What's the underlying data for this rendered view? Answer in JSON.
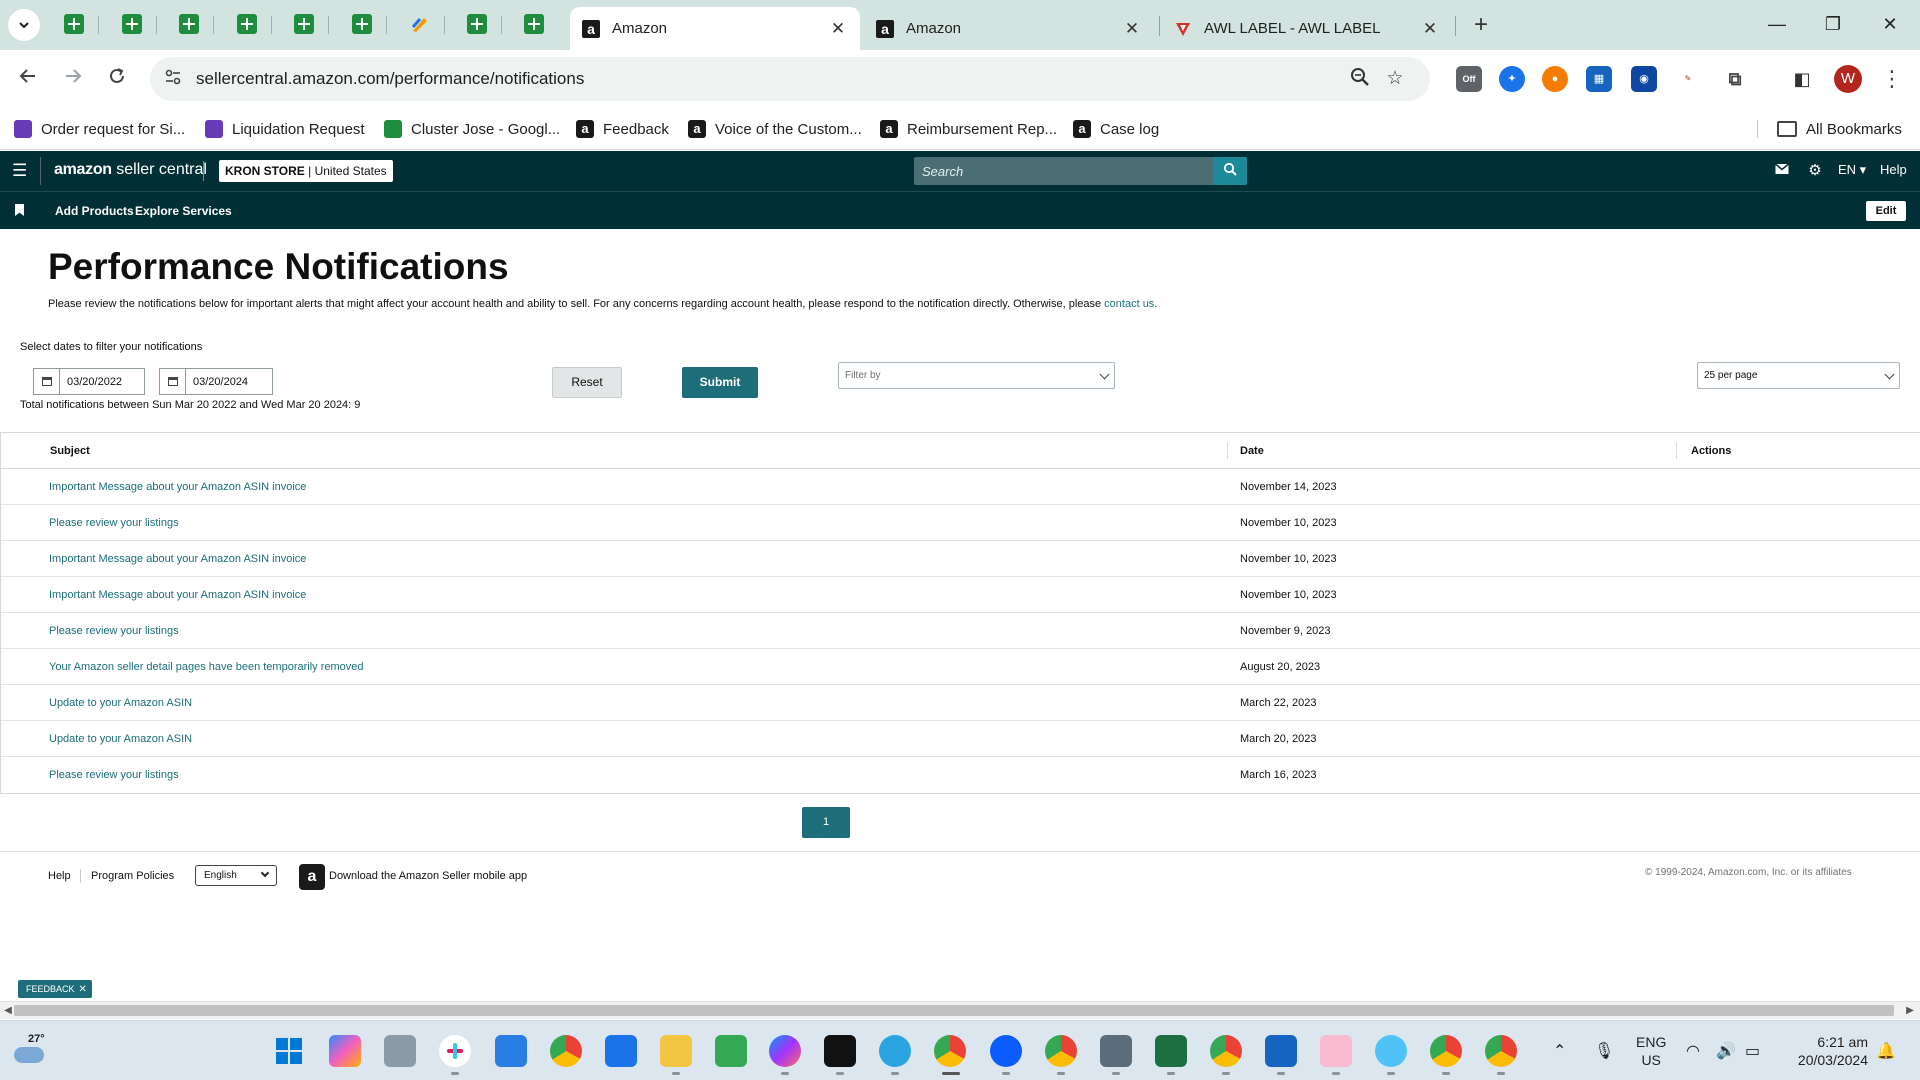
{
  "browser": {
    "tabs": [
      {
        "title": "Amazon",
        "active": true,
        "favicon": "amazon-icon"
      },
      {
        "title": "Amazon",
        "active": false,
        "favicon": "amazon-icon"
      },
      {
        "title": "AWL LABEL - AWL LABEL",
        "active": false,
        "favicon": "awl-label-icon"
      }
    ],
    "url": "sellercentral.amazon.com/performance/notifications",
    "bookmarks": [
      {
        "label": "Order request for Si...",
        "icon": "google-forms-icon"
      },
      {
        "label": "Liquidation Request",
        "icon": "google-forms-icon"
      },
      {
        "label": "Cluster Jose - Googl...",
        "icon": "google-sheets-icon"
      },
      {
        "label": "Feedback",
        "icon": "amazon-icon"
      },
      {
        "label": "Voice of the Custom...",
        "icon": "amazon-icon"
      },
      {
        "label": "Reimbursement Rep...",
        "icon": "amazon-icon"
      },
      {
        "label": "Case log",
        "icon": "amazon-icon"
      }
    ],
    "all_bookmarks": "All Bookmarks",
    "profile_initial": "W",
    "extension_badge": "Off"
  },
  "header": {
    "logo_brand": "amazon",
    "logo_product": "seller central",
    "store_name": "KRON STORE",
    "store_region": "United States",
    "search_placeholder": "Search",
    "language": "EN",
    "help": "Help"
  },
  "subnav": {
    "items": [
      "Add Products",
      "Explore Services"
    ],
    "edit": "Edit"
  },
  "page": {
    "title": "Performance Notifications",
    "intro": "Please review the notifications below for important alerts that might affect your account health and ability to sell. For any concerns regarding account health, please respond to the notification directly. Otherwise, please ",
    "contact_link": "contact us",
    "intro_end": ".",
    "filter_label": "Select dates to filter your notifications",
    "date_from": "03/20/2022",
    "date_to": "03/20/2024",
    "total_text": "Total notifications between Sun Mar 20 2022 and Wed Mar 20 2024: 9",
    "reset": "Reset",
    "submit": "Submit",
    "filter_by_placeholder": "Filter by",
    "per_page": "25 per page"
  },
  "table": {
    "headers": {
      "subject": "Subject",
      "date": "Date",
      "actions": "Actions"
    },
    "rows": [
      {
        "subject": "Important Message about your Amazon ASIN invoice",
        "date": "November 14, 2023"
      },
      {
        "subject": "Please review your listings",
        "date": "November 10, 2023"
      },
      {
        "subject": "Important Message about your Amazon ASIN invoice",
        "date": "November 10, 2023"
      },
      {
        "subject": "Important Message about your Amazon ASIN invoice",
        "date": "November 10, 2023"
      },
      {
        "subject": "Please review your listings",
        "date": "November 9, 2023"
      },
      {
        "subject": "Your Amazon seller detail pages have been temporarily removed",
        "date": "August 20, 2023"
      },
      {
        "subject": "Update to your Amazon ASIN",
        "date": "March 22, 2023"
      },
      {
        "subject": "Update to your Amazon ASIN",
        "date": "March 20, 2023"
      },
      {
        "subject": "Please review your listings",
        "date": "March 16, 2023"
      }
    ]
  },
  "pagination": {
    "current": "1"
  },
  "footer": {
    "help": "Help",
    "program_policies": "Program Policies",
    "language": "English",
    "mobile_app": "Download the Amazon Seller mobile app",
    "copyright": "© 1999-2024, Amazon.com, Inc. or its affiliates"
  },
  "feedback": "FEEDBACK",
  "taskbar": {
    "temperature": "27°",
    "lang_line1": "ENG",
    "lang_line2": "US",
    "time": "6:21 am",
    "date": "20/03/2024"
  }
}
